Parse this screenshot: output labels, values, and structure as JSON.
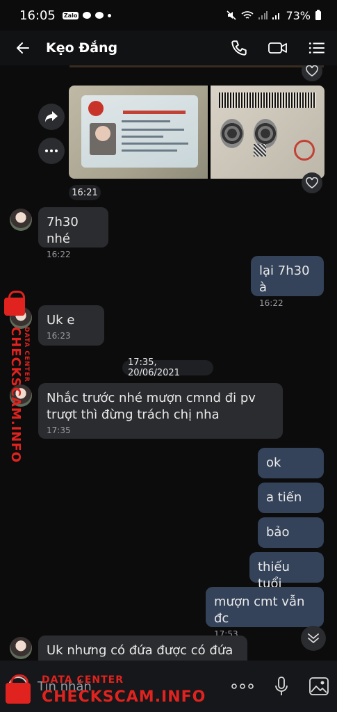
{
  "status_bar": {
    "time": "16:05",
    "notif_icons": [
      "zalo-icon",
      "messenger-icon",
      "chat-bubble-icon",
      "dot-icon"
    ],
    "battery": "73%"
  },
  "header": {
    "title": "Kẹo Đắng",
    "actions": [
      "phone-call-icon",
      "video-call-icon",
      "menu-list-icon"
    ]
  },
  "messages": [
    {
      "dir": "in",
      "text": "7h30 nhé",
      "time": "16:22"
    },
    {
      "dir": "out",
      "text": "lại 7h30 à",
      "time": "16:22"
    },
    {
      "dir": "in",
      "text": "Uk e",
      "time": "16:23"
    },
    {
      "dir": "in",
      "text": "Nhắc trước nhé mượn cmnd đi pv trượt thì đừng trách chị nha",
      "time": "17:35"
    },
    {
      "dir": "out",
      "text": "ok",
      "time": ""
    },
    {
      "dir": "out",
      "text": "a tiến",
      "time": ""
    },
    {
      "dir": "out",
      "text": "bảo",
      "time": ""
    },
    {
      "dir": "out",
      "text": "thiếu tuổi",
      "time": ""
    },
    {
      "dir": "out",
      "text": "mượn cmt vẫn đc",
      "time": "17:53"
    },
    {
      "dir": "in",
      "text": "Uk nhưng có đứa được có đứa ko",
      "time": ""
    }
  ],
  "photo_time": "16:21",
  "date_separator": "17:35, 20/06/2021",
  "input": {
    "placeholder": "Tin nhắn"
  },
  "watermark": {
    "main": "CHECKSCAM.INFO",
    "sub": "DATA CENTER",
    "color": "#e0231e"
  }
}
